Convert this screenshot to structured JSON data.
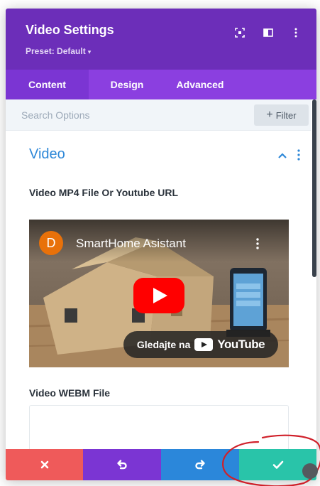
{
  "header": {
    "title": "Video Settings",
    "preset_label": "Preset: Default",
    "preset_caret": "▾"
  },
  "tabs": [
    {
      "label": "Content",
      "active": true
    },
    {
      "label": "Design",
      "active": false
    },
    {
      "label": "Advanced",
      "active": false
    }
  ],
  "search": {
    "placeholder": "Search Options",
    "filter_plus": "+",
    "filter_label": "Filter"
  },
  "section": {
    "title": "Video"
  },
  "fields": {
    "mp4_label": "Video MP4 File Or Youtube URL",
    "webm_label": "Video WEBM File"
  },
  "video": {
    "channel_initial": "D",
    "title": "SmartHome Asistant",
    "watch_on": "Gledajte na",
    "youtube_word": "YouTube"
  },
  "colors": {
    "header": "#6c2eb9",
    "tabs": "#8b3fe0",
    "section_title": "#2e88d8",
    "cancel": "#ef5a5a",
    "undo": "#7b35d3",
    "redo": "#2b87da",
    "save": "#29c4a9",
    "annotation": "#d0202a"
  },
  "icons": {
    "header": [
      "expand-icon",
      "split-view-icon",
      "more-vertical-icon"
    ],
    "footer": [
      "close-icon",
      "undo-icon",
      "redo-icon",
      "check-icon"
    ]
  }
}
